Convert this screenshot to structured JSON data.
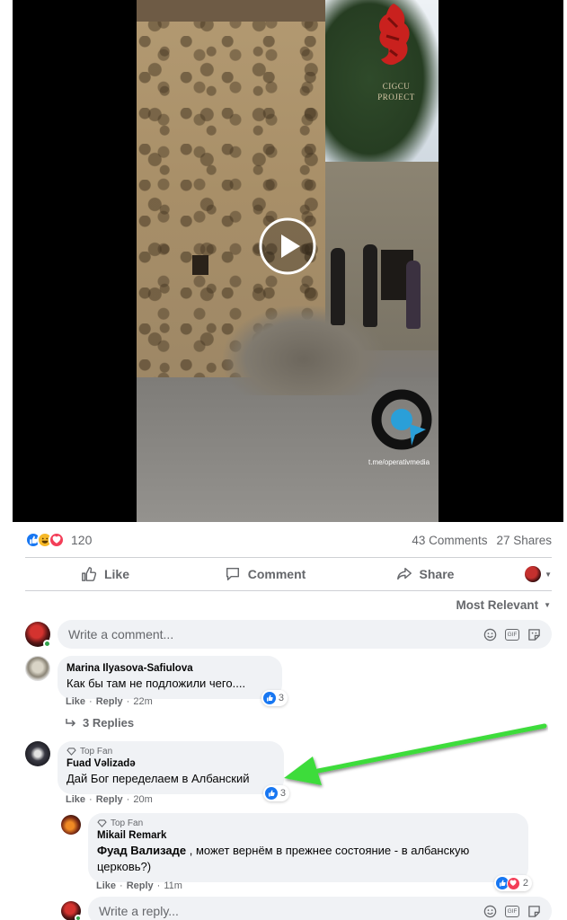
{
  "video": {
    "watermark_top": "CIGCU PROJECT",
    "watermark_bottom": "t.me/operativmedia"
  },
  "stats": {
    "reaction_count": "120",
    "comments": "43 Comments",
    "shares": "27 Shares",
    "reaction_types": [
      "like-icon",
      "haha-icon",
      "love-icon"
    ]
  },
  "actions": {
    "like": "Like",
    "comment": "Comment",
    "share": "Share"
  },
  "sort": {
    "label": "Most Relevant"
  },
  "composer": {
    "placeholder": "Write a comment..."
  },
  "comments": [
    {
      "name": "Marina Ilyasova-Safiulova",
      "text": "Как бы там не подложили чего....",
      "reactions": "3",
      "like": "Like",
      "reply": "Reply",
      "time": "22m",
      "replies_label": "3 Replies"
    },
    {
      "badge": "Top Fan",
      "name": "Fuad Vəlizadə",
      "text": "Дай Бог переделаем в Албанский",
      "reactions": "3",
      "like": "Like",
      "reply": "Reply",
      "time": "20m"
    }
  ],
  "reply": {
    "badge": "Top Fan",
    "name": "Mikail Remark",
    "mention": "Фуад Вализаде",
    "text_line1": " , может вернём в прежнее состояние - в албанскую",
    "text_line2": "церковь?)",
    "reactions": "2",
    "like": "Like",
    "reply": "Reply",
    "time": "11m"
  },
  "reply_composer": {
    "placeholder": "Write a reply..."
  },
  "colors": {
    "accent": "#1877f2",
    "love": "#f33e58",
    "arrow": "#3ddc3a",
    "muted": "#65676b"
  }
}
